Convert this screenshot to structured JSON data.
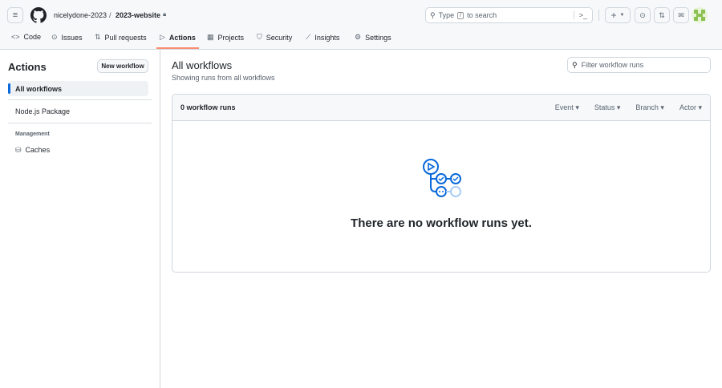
{
  "header": {
    "owner": "nicelydone-2023",
    "separator": "/",
    "repo": "2023-website",
    "search_placeholder_pre": "Type",
    "search_key": "/",
    "search_placeholder_post": "to search",
    "plus": "+"
  },
  "tabs": [
    {
      "label": "Code"
    },
    {
      "label": "Issues"
    },
    {
      "label": "Pull requests"
    },
    {
      "label": "Actions"
    },
    {
      "label": "Projects"
    },
    {
      "label": "Security"
    },
    {
      "label": "Insights"
    },
    {
      "label": "Settings"
    }
  ],
  "sidebar": {
    "title": "Actions",
    "new_workflow": "New workflow",
    "items": [
      {
        "label": "All workflows"
      },
      {
        "label": "Node.js Package"
      }
    ],
    "management_heading": "Management",
    "caches": "Caches"
  },
  "main": {
    "title": "All workflows",
    "subtitle": "Showing runs from all workflows",
    "filter_placeholder": "Filter workflow runs",
    "runs_count": "0 workflow runs",
    "filters": [
      "Event",
      "Status",
      "Branch",
      "Actor"
    ],
    "empty_message": "There are no workflow runs yet."
  },
  "colors": {
    "accent": "#0969da",
    "active_tab": "#fd8c73"
  }
}
